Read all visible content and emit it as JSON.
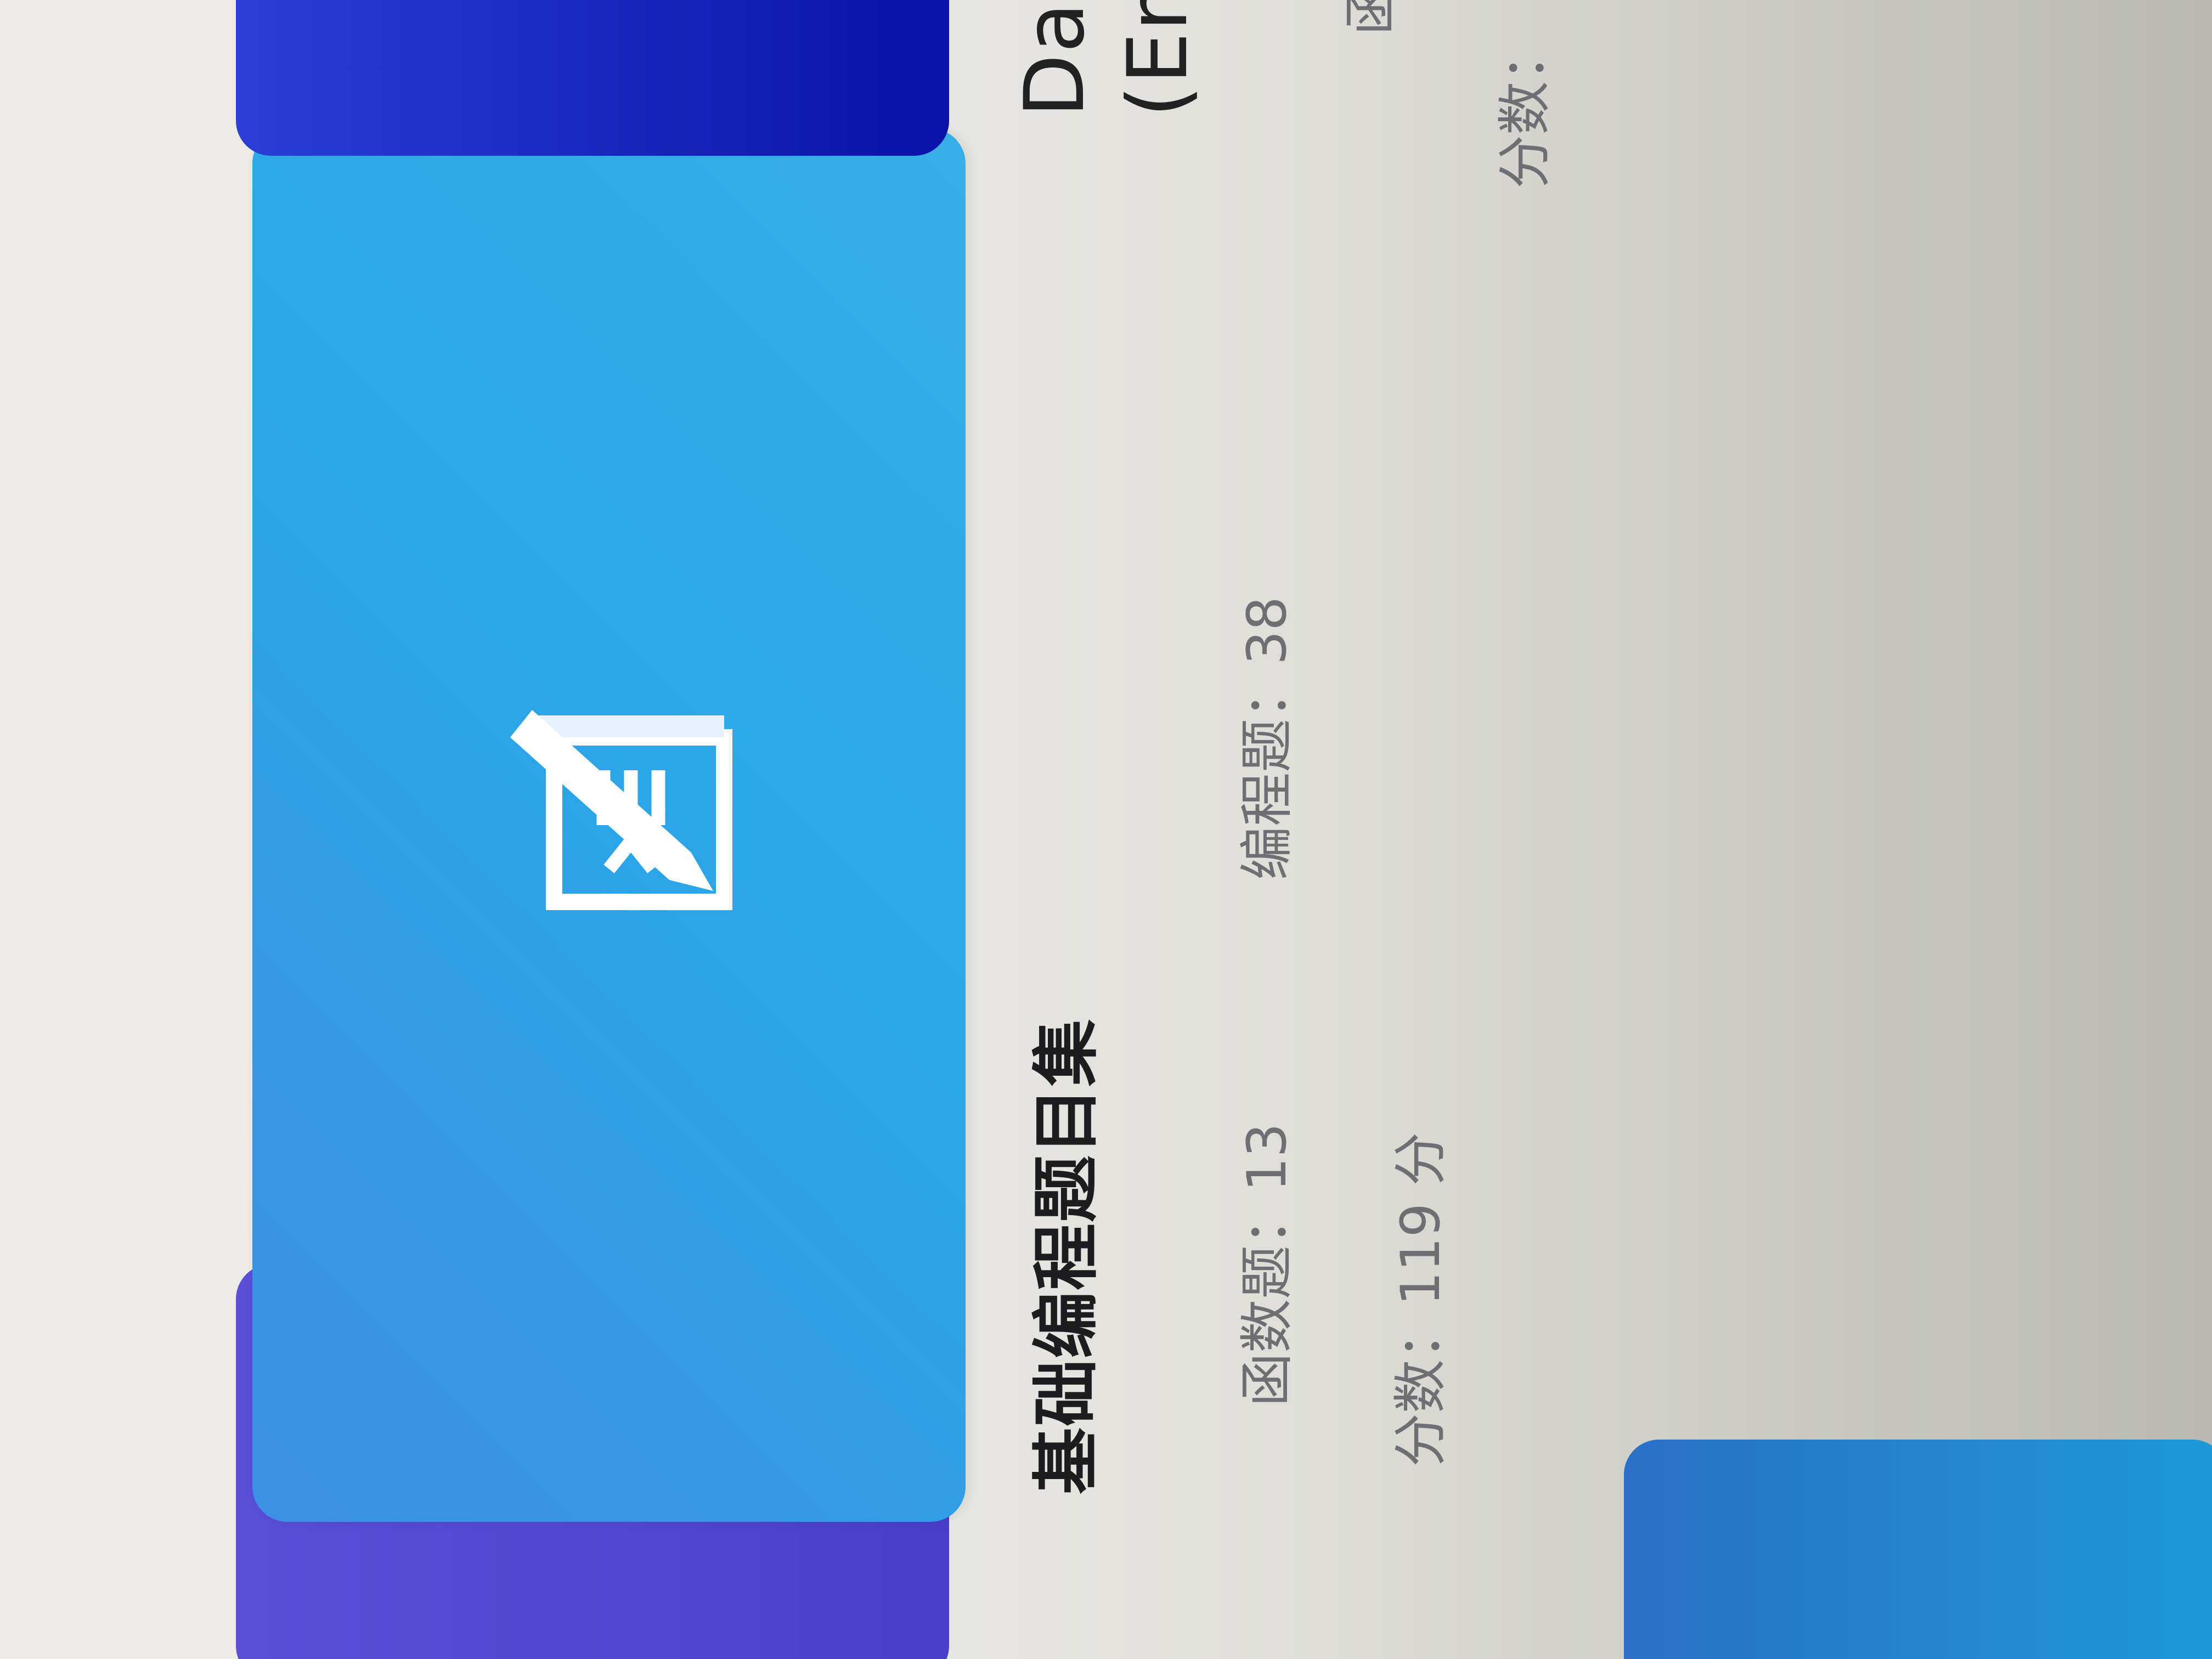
{
  "cards": {
    "main": {
      "title": "基础编程题目集",
      "function_label": "函数题：",
      "function_count": "13",
      "programming_label": "编程题：",
      "programming_count": "38",
      "score_label": "分数：",
      "score_value": "119 分",
      "cover_icon": "edit-document-icon",
      "cover_colors": [
        "#3d8fe6",
        "#2aa6e8"
      ]
    },
    "right": {
      "title_line1": "Data",
      "title_line2": "(Eng",
      "function_label": "函数",
      "score_label": "分数："
    }
  }
}
